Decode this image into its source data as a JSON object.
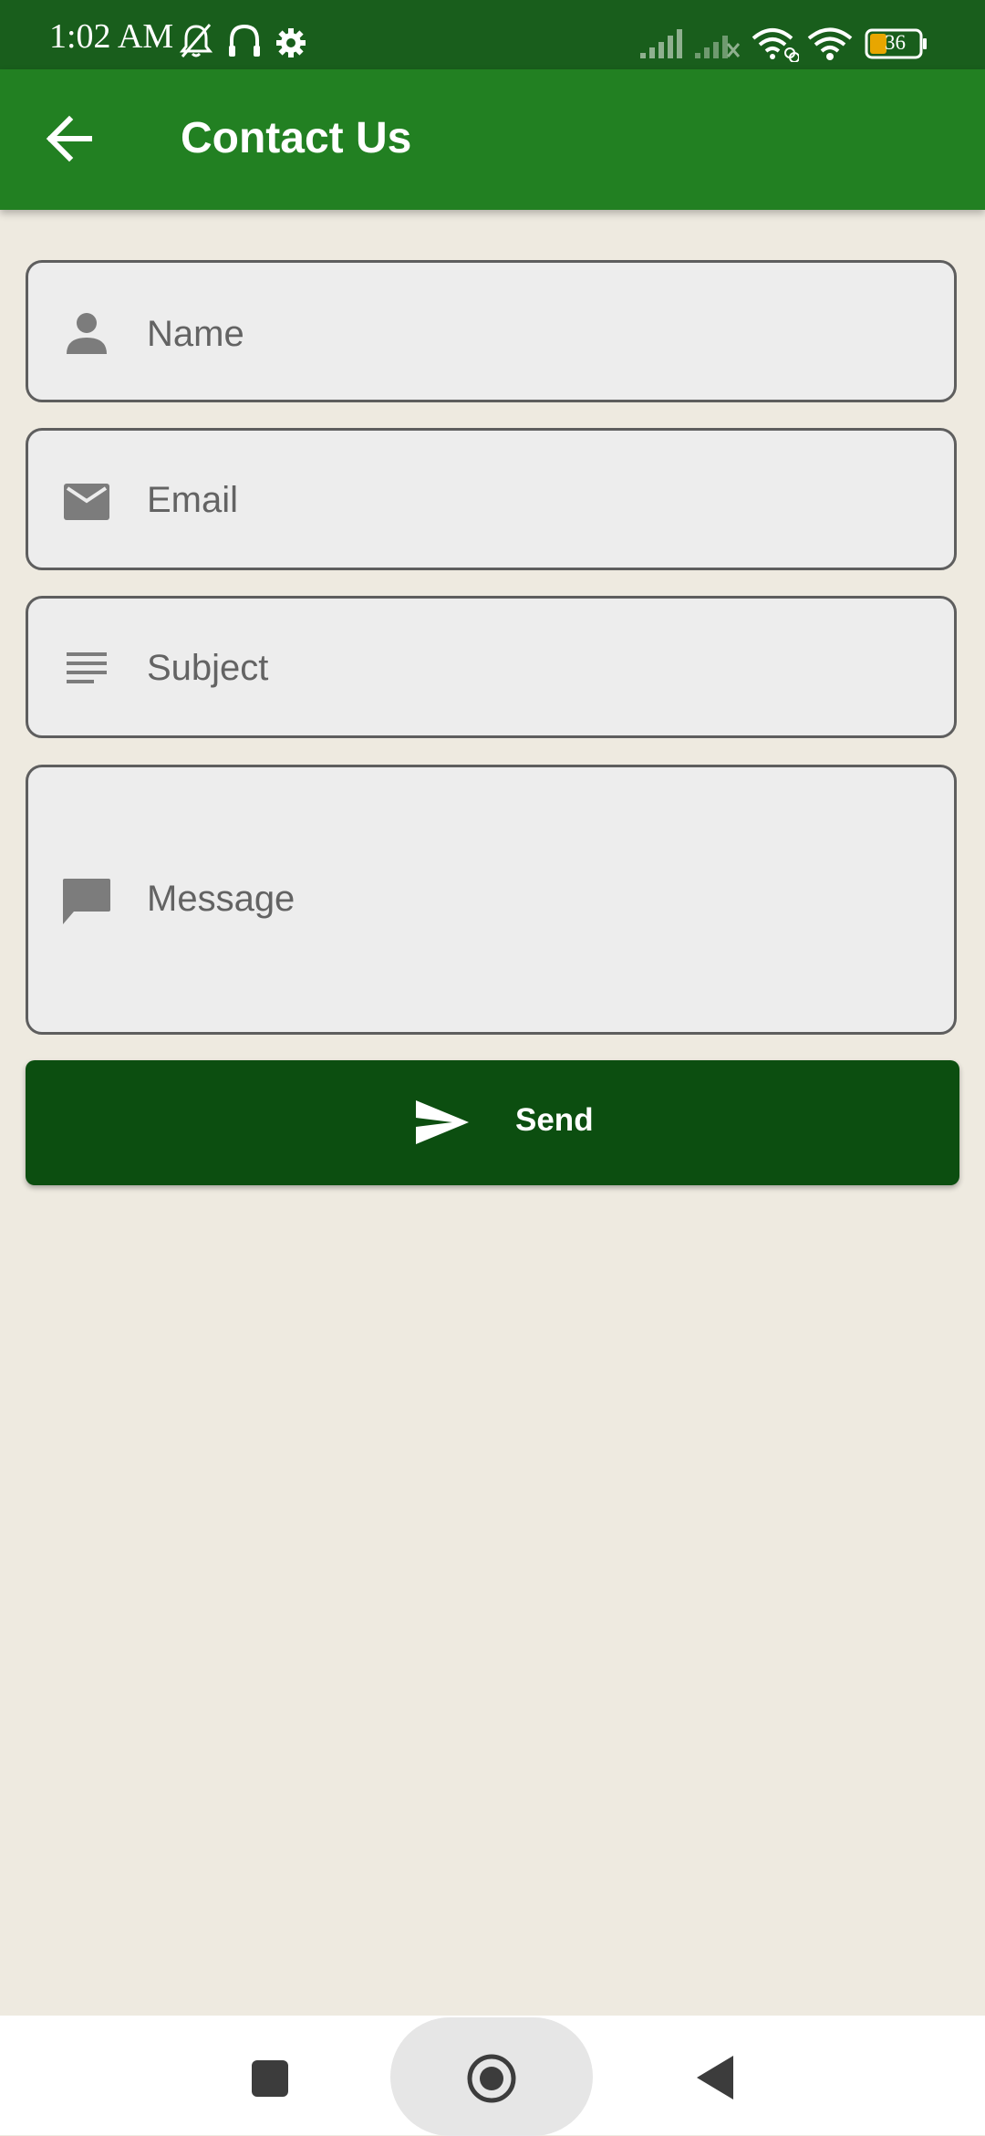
{
  "status_bar": {
    "time": "1:02 AM",
    "battery": "36",
    "icons": [
      "bell-off-icon",
      "headset-icon",
      "settings-icon",
      "signal-icon",
      "signal-no-service-icon",
      "wifi-link-icon",
      "wifi-icon",
      "battery-icon"
    ]
  },
  "app_bar": {
    "back_icon": "arrow-left-icon",
    "title": "Contact Us"
  },
  "form": {
    "name": {
      "placeholder": "Name",
      "icon": "person-icon"
    },
    "email": {
      "placeholder": "Email",
      "icon": "mail-icon"
    },
    "subject": {
      "placeholder": "Subject",
      "icon": "subject-lines-icon"
    },
    "message": {
      "placeholder": "Message",
      "icon": "chat-bubble-icon"
    }
  },
  "send_button": {
    "label": "Send",
    "icon": "send-icon"
  },
  "nav_bar": {
    "icons": [
      "recents-icon",
      "home-icon",
      "back-icon"
    ]
  },
  "colors": {
    "status_bar": "#195e1c",
    "app_bar": "#228022",
    "button": "#0c4e10",
    "background": "#eeeae0",
    "field_background": "#ededed",
    "field_border": "#5e5e5e",
    "placeholder": "#636363"
  }
}
